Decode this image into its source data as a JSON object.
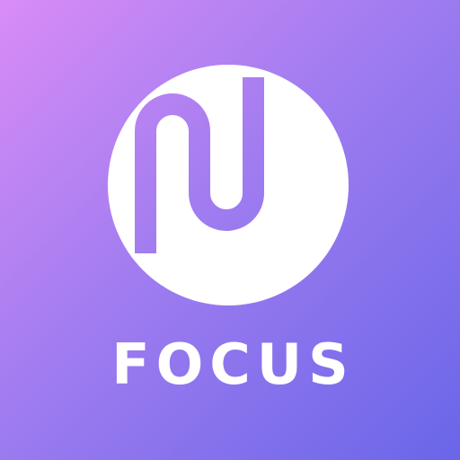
{
  "icon": {
    "name": "focus-logo-icon",
    "background_gradient": [
      "#d98cf6",
      "#a07cf0",
      "#6966e8"
    ],
    "mark_color": "#ffffff"
  },
  "app": {
    "name": "FOCUS"
  }
}
